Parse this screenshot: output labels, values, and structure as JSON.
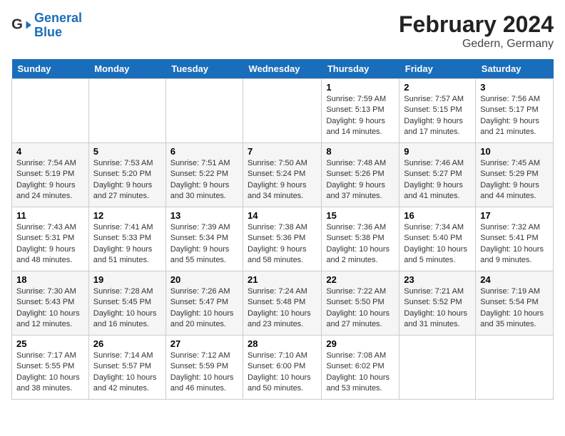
{
  "header": {
    "logo_line1": "General",
    "logo_line2": "Blue",
    "title": "February 2024",
    "subtitle": "Gedern, Germany"
  },
  "days_of_week": [
    "Sunday",
    "Monday",
    "Tuesday",
    "Wednesday",
    "Thursday",
    "Friday",
    "Saturday"
  ],
  "weeks": [
    [
      {
        "day": "",
        "info": ""
      },
      {
        "day": "",
        "info": ""
      },
      {
        "day": "",
        "info": ""
      },
      {
        "day": "",
        "info": ""
      },
      {
        "day": "1",
        "info": "Sunrise: 7:59 AM\nSunset: 5:13 PM\nDaylight: 9 hours and 14 minutes."
      },
      {
        "day": "2",
        "info": "Sunrise: 7:57 AM\nSunset: 5:15 PM\nDaylight: 9 hours and 17 minutes."
      },
      {
        "day": "3",
        "info": "Sunrise: 7:56 AM\nSunset: 5:17 PM\nDaylight: 9 hours and 21 minutes."
      }
    ],
    [
      {
        "day": "4",
        "info": "Sunrise: 7:54 AM\nSunset: 5:19 PM\nDaylight: 9 hours and 24 minutes."
      },
      {
        "day": "5",
        "info": "Sunrise: 7:53 AM\nSunset: 5:20 PM\nDaylight: 9 hours and 27 minutes."
      },
      {
        "day": "6",
        "info": "Sunrise: 7:51 AM\nSunset: 5:22 PM\nDaylight: 9 hours and 30 minutes."
      },
      {
        "day": "7",
        "info": "Sunrise: 7:50 AM\nSunset: 5:24 PM\nDaylight: 9 hours and 34 minutes."
      },
      {
        "day": "8",
        "info": "Sunrise: 7:48 AM\nSunset: 5:26 PM\nDaylight: 9 hours and 37 minutes."
      },
      {
        "day": "9",
        "info": "Sunrise: 7:46 AM\nSunset: 5:27 PM\nDaylight: 9 hours and 41 minutes."
      },
      {
        "day": "10",
        "info": "Sunrise: 7:45 AM\nSunset: 5:29 PM\nDaylight: 9 hours and 44 minutes."
      }
    ],
    [
      {
        "day": "11",
        "info": "Sunrise: 7:43 AM\nSunset: 5:31 PM\nDaylight: 9 hours and 48 minutes."
      },
      {
        "day": "12",
        "info": "Sunrise: 7:41 AM\nSunset: 5:33 PM\nDaylight: 9 hours and 51 minutes."
      },
      {
        "day": "13",
        "info": "Sunrise: 7:39 AM\nSunset: 5:34 PM\nDaylight: 9 hours and 55 minutes."
      },
      {
        "day": "14",
        "info": "Sunrise: 7:38 AM\nSunset: 5:36 PM\nDaylight: 9 hours and 58 minutes."
      },
      {
        "day": "15",
        "info": "Sunrise: 7:36 AM\nSunset: 5:38 PM\nDaylight: 10 hours and 2 minutes."
      },
      {
        "day": "16",
        "info": "Sunrise: 7:34 AM\nSunset: 5:40 PM\nDaylight: 10 hours and 5 minutes."
      },
      {
        "day": "17",
        "info": "Sunrise: 7:32 AM\nSunset: 5:41 PM\nDaylight: 10 hours and 9 minutes."
      }
    ],
    [
      {
        "day": "18",
        "info": "Sunrise: 7:30 AM\nSunset: 5:43 PM\nDaylight: 10 hours and 12 minutes."
      },
      {
        "day": "19",
        "info": "Sunrise: 7:28 AM\nSunset: 5:45 PM\nDaylight: 10 hours and 16 minutes."
      },
      {
        "day": "20",
        "info": "Sunrise: 7:26 AM\nSunset: 5:47 PM\nDaylight: 10 hours and 20 minutes."
      },
      {
        "day": "21",
        "info": "Sunrise: 7:24 AM\nSunset: 5:48 PM\nDaylight: 10 hours and 23 minutes."
      },
      {
        "day": "22",
        "info": "Sunrise: 7:22 AM\nSunset: 5:50 PM\nDaylight: 10 hours and 27 minutes."
      },
      {
        "day": "23",
        "info": "Sunrise: 7:21 AM\nSunset: 5:52 PM\nDaylight: 10 hours and 31 minutes."
      },
      {
        "day": "24",
        "info": "Sunrise: 7:19 AM\nSunset: 5:54 PM\nDaylight: 10 hours and 35 minutes."
      }
    ],
    [
      {
        "day": "25",
        "info": "Sunrise: 7:17 AM\nSunset: 5:55 PM\nDaylight: 10 hours and 38 minutes."
      },
      {
        "day": "26",
        "info": "Sunrise: 7:14 AM\nSunset: 5:57 PM\nDaylight: 10 hours and 42 minutes."
      },
      {
        "day": "27",
        "info": "Sunrise: 7:12 AM\nSunset: 5:59 PM\nDaylight: 10 hours and 46 minutes."
      },
      {
        "day": "28",
        "info": "Sunrise: 7:10 AM\nSunset: 6:00 PM\nDaylight: 10 hours and 50 minutes."
      },
      {
        "day": "29",
        "info": "Sunrise: 7:08 AM\nSunset: 6:02 PM\nDaylight: 10 hours and 53 minutes."
      },
      {
        "day": "",
        "info": ""
      },
      {
        "day": "",
        "info": ""
      }
    ]
  ]
}
